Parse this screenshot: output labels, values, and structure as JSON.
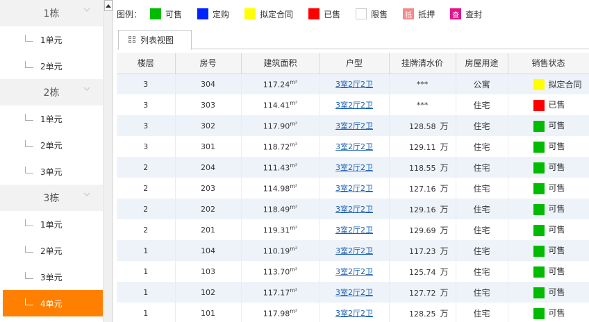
{
  "sidebar": {
    "groups": [
      {
        "name": "1栋",
        "units": [
          "1单元",
          "2单元"
        ]
      },
      {
        "name": "2栋",
        "units": [
          "1单元",
          "2单元",
          "3单元"
        ]
      },
      {
        "name": "3栋",
        "units": [
          "1单元",
          "2单元",
          "3单元",
          "4单元"
        ]
      }
    ],
    "active": "3栋 4单元"
  },
  "legend": {
    "title": "图例：",
    "items": [
      {
        "label": "可售",
        "color": "#00bb00"
      },
      {
        "label": "定购",
        "color": "#0022ff"
      },
      {
        "label": "拟定合同",
        "color": "#ffff00"
      },
      {
        "label": "已售",
        "color": "#ff0000"
      },
      {
        "label": "限售",
        "color": "#ffffff"
      },
      {
        "label": "抵押",
        "color": "#f28c8c",
        "glyph": "抵"
      },
      {
        "label": "查封",
        "color": "#e0148c",
        "glyph": "查"
      }
    ]
  },
  "tab": {
    "label": "列表视图"
  },
  "table": {
    "headers": [
      "楼层",
      "房号",
      "建筑面积",
      "户型",
      "挂牌清水价",
      "房屋用途",
      "销售状态"
    ],
    "area_unit": "m²",
    "price_unit": "万",
    "rows": [
      {
        "floor": "3",
        "room": "304",
        "area": "117.24",
        "layout": "3室2厅2卫",
        "price": "***",
        "usage": "公寓",
        "status": "拟定合同",
        "status_color": "#ffff00"
      },
      {
        "floor": "3",
        "room": "303",
        "area": "114.41",
        "layout": "3室2厅2卫",
        "price": "***",
        "usage": "住宅",
        "status": "已售",
        "status_color": "#ff0000"
      },
      {
        "floor": "3",
        "room": "302",
        "area": "117.90",
        "layout": "3室2厅2卫",
        "price": "128.58",
        "usage": "住宅",
        "status": "可售",
        "status_color": "#00bb00"
      },
      {
        "floor": "3",
        "room": "301",
        "area": "118.72",
        "layout": "3室2厅2卫",
        "price": "129.11",
        "usage": "住宅",
        "status": "可售",
        "status_color": "#00bb00"
      },
      {
        "floor": "2",
        "room": "204",
        "area": "111.43",
        "layout": "3室2厅2卫",
        "price": "118.55",
        "usage": "住宅",
        "status": "可售",
        "status_color": "#00bb00"
      },
      {
        "floor": "2",
        "room": "203",
        "area": "114.98",
        "layout": "3室2厅2卫",
        "price": "127.16",
        "usage": "住宅",
        "status": "可售",
        "status_color": "#00bb00"
      },
      {
        "floor": "2",
        "room": "202",
        "area": "118.49",
        "layout": "3室2厅2卫",
        "price": "129.16",
        "usage": "住宅",
        "status": "可售",
        "status_color": "#00bb00"
      },
      {
        "floor": "2",
        "room": "201",
        "area": "119.31",
        "layout": "3室2厅2卫",
        "price": "129.69",
        "usage": "住宅",
        "status": "可售",
        "status_color": "#00bb00"
      },
      {
        "floor": "1",
        "room": "104",
        "area": "110.19",
        "layout": "3室2厅2卫",
        "price": "117.23",
        "usage": "住宅",
        "status": "可售",
        "status_color": "#00bb00"
      },
      {
        "floor": "1",
        "room": "103",
        "area": "113.70",
        "layout": "3室2厅2卫",
        "price": "125.74",
        "usage": "住宅",
        "status": "可售",
        "status_color": "#00bb00"
      },
      {
        "floor": "1",
        "room": "102",
        "area": "117.17",
        "layout": "3室2厅2卫",
        "price": "127.72",
        "usage": "住宅",
        "status": "可售",
        "status_color": "#00bb00"
      },
      {
        "floor": "1",
        "room": "101",
        "area": "117.98",
        "layout": "3室2厅2卫",
        "price": "128.25",
        "usage": "住宅",
        "status": "可售",
        "status_color": "#00bb00"
      }
    ]
  }
}
